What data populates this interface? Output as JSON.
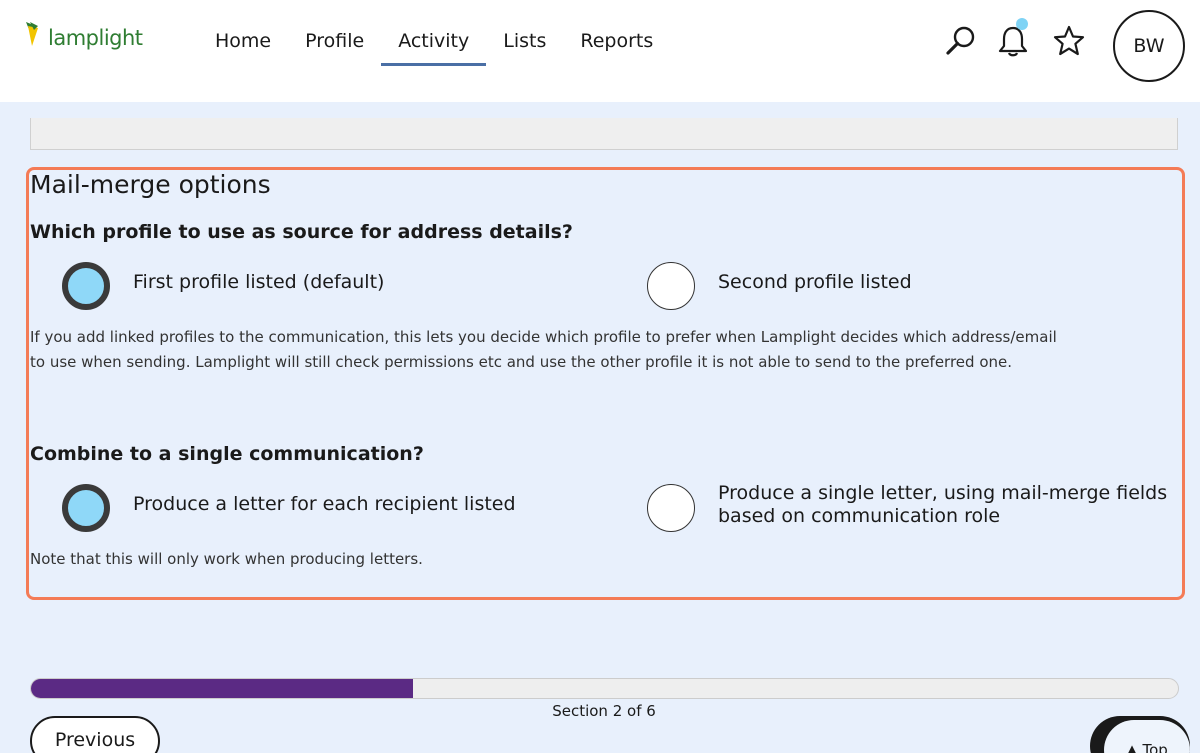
{
  "header": {
    "logo_text": "lamplight",
    "nav": [
      {
        "label": "Home",
        "active": false
      },
      {
        "label": "Profile",
        "active": false
      },
      {
        "label": "Activity",
        "active": true
      },
      {
        "label": "Lists",
        "active": false
      },
      {
        "label": "Reports",
        "active": false
      }
    ],
    "icons": [
      "search-icon",
      "bell-icon",
      "star-icon"
    ],
    "avatar_initials": "BW",
    "colors": {
      "logo_green": "#2f7d32",
      "active_underline": "#4a6fa5",
      "notification_dot": "#7fd3f5"
    }
  },
  "mailmerge": {
    "title": "Mail-merge options",
    "profile_question": "Which profile to use as source for address details?",
    "profile_options": [
      {
        "label": "First profile listed (default)",
        "checked": true
      },
      {
        "label": "Second profile listed",
        "checked": false
      }
    ],
    "profile_help": "If you add linked profiles to the communication, this lets you decide which profile to prefer when Lamplight decides which address/email to use when sending. Lamplight will still check permissions etc and use the other profile it is not able to send to the preferred one.",
    "combine_question": "Combine to a single communication?",
    "combine_options": [
      {
        "label": "Produce a letter for each recipient listed",
        "checked": true
      },
      {
        "label": "Produce a single letter, using mail-merge fields based on communication role",
        "checked": false
      }
    ],
    "combine_help": "Note that this will only work when producing letters.",
    "colors": {
      "highlight_border": "#f47b56",
      "radio_checked_fill": "#8fd8f8"
    }
  },
  "progress": {
    "label": "Section 2 of 6",
    "current": 2,
    "total": 6,
    "fill_fraction": 0.333,
    "color": "#5b2a84"
  },
  "footer": {
    "previous_label": "Previous",
    "top_label": "▲ Top"
  }
}
